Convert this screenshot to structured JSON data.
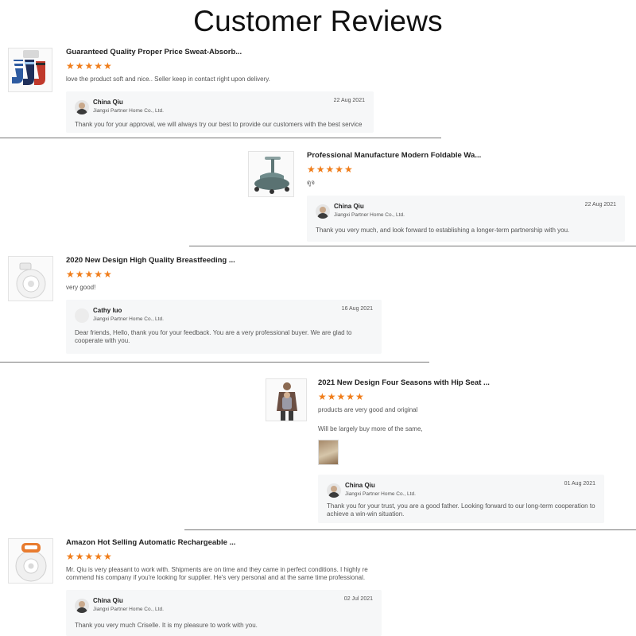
{
  "page_title": "Customer Reviews",
  "colors": {
    "star": "#f07d1a",
    "reply_bg": "#f6f7f8"
  },
  "reviews": [
    {
      "product_title": "Guaranteed Quality Proper Price Sweat-Absorb...",
      "stars": "★★★★★",
      "text": "love the product soft and nice.. Seller keep in contact right upon delivery.",
      "image": "socks-product-image",
      "reply": {
        "name": "China Qiu",
        "company": "Jiangxi Partner Home Co., Ltd.",
        "date": "22 Aug 2021",
        "message": "Thank you for your approval, we will always try our best to provide our customers with the best service"
      }
    },
    {
      "product_title": "Professional Manufacture Modern Foldable Wa...",
      "stars": "★★★★★",
      "text": "ดูจ",
      "image": "baby-walker-product-image",
      "reply": {
        "name": "China Qiu",
        "company": "Jiangxi Partner Home Co., Ltd.",
        "date": "22 Aug 2021",
        "message": "Thank you very much, and look forward to establishing a longer-term partnership with you."
      }
    },
    {
      "product_title": "2020 New Design High Quality Breastfeeding ...",
      "stars": "★★★★★",
      "text": "very good!",
      "image": "breast-pump-product-image",
      "reply": {
        "name": "Cathy luo",
        "company": "Jiangxi Partner Home Co., Ltd.",
        "date": "16 Aug 2021",
        "message": "Dear friends, Hello, thank you for your feedback. You are a very professional buyer. We are glad to cooperate with you."
      }
    },
    {
      "product_title": "2021 New Design Four Seasons with Hip Seat ...",
      "stars": "★★★★★",
      "text": "products are very good and original",
      "extra_text": "Will be largely buy more of the same,",
      "image": "baby-carrier-product-image",
      "reply": {
        "name": "China Qiu",
        "company": "Jiangxi Partner Home Co., Ltd.",
        "date": "01 Aug 2021",
        "message": "Thank you for your trust, you are a good father. Looking forward to our long-term cooperation to achieve a win-win situation."
      }
    },
    {
      "product_title": "Amazon Hot Selling Automatic Rechargeable ...",
      "stars": "★★★★★",
      "text": "Mr. Qiu is very pleasant to work with. Shipments are on time and they came in perfect conditions. I highly re commend his company if you're looking for supplier. He's very personal and at the same time professional.",
      "image": "wearable-pump-product-image",
      "reply": {
        "name": "China Qiu",
        "company": "Jiangxi Partner Home Co., Ltd.",
        "date": "02 Jul 2021",
        "message": "Thank you very much Criselle. It is my pleasure to work with you."
      }
    }
  ]
}
